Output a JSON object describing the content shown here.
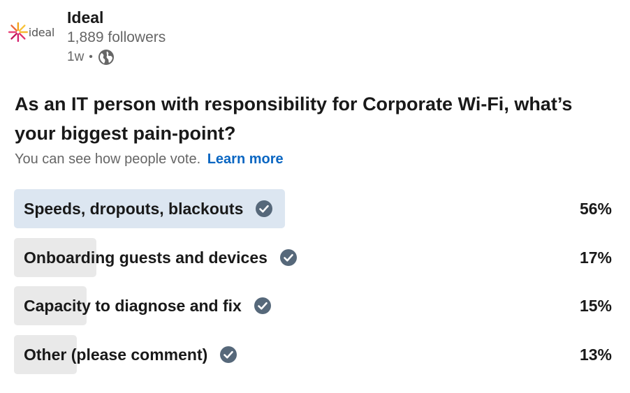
{
  "post": {
    "logo_text": "ideal",
    "org_name": "Ideal",
    "followers": "1,889 followers",
    "time": "1w",
    "separator": "•",
    "visibility_icon": "globe-icon"
  },
  "poll": {
    "question": "As an IT person with responsibility for Corporate Wi-Fi, what’s your biggest pain-point?",
    "vote_info": "You can see how people vote.",
    "learn_more": "Learn more",
    "options": [
      {
        "label": "Speeds, dropouts, blackouts",
        "percent": "56%",
        "value": 56,
        "selected": true
      },
      {
        "label": "Onboarding guests and devices",
        "percent": "17%",
        "value": 17,
        "selected": false
      },
      {
        "label": "Capacity to diagnose and fix",
        "percent": "15%",
        "value": 15,
        "selected": false
      },
      {
        "label": "Other (please comment)",
        "percent": "13%",
        "value": 13,
        "selected": false
      }
    ]
  },
  "colors": {
    "accent": "#0a66c2",
    "selected_bar": "#dce6f1",
    "normal_bar": "#e9e9e9",
    "check_icon": "#56687a"
  }
}
